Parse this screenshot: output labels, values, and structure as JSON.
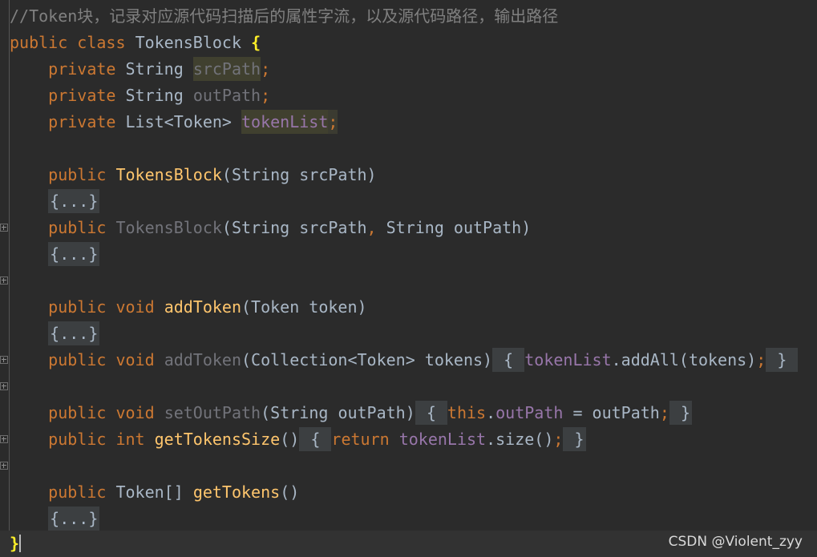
{
  "colors": {
    "background": "#2b2b2b",
    "keyword": "#cc7832",
    "method_declaration": "#ffc66d",
    "field": "#9876aa",
    "comment": "#808080",
    "unused": "#72737a",
    "default_text": "#a9b7c6",
    "matched_brace": "#ffef28",
    "fold_chip_background": "#3c3f41"
  },
  "code": {
    "comment": "//Token块，记录对应源代码扫描后的属性字流，以及源代码路径，输出路径",
    "class_decl": {
      "kw1": "public",
      "kw2": "class",
      "name": "TokensBlock",
      "open": "{"
    },
    "fields": [
      {
        "mod": "private",
        "type": "String",
        "name": "srcPath",
        "semi": ";"
      },
      {
        "mod": "private",
        "type": "String",
        "name": "outPath",
        "semi": ";"
      },
      {
        "mod": "private",
        "type": "List<Token>",
        "name": "tokenList",
        "semi": ";"
      }
    ],
    "ctor1": {
      "mod": "public",
      "name": "TokensBlock",
      "params": "(String srcPath)"
    },
    "ctor2": {
      "mod": "public",
      "name": "TokensBlock",
      "params_a": "(String srcPath",
      "comma": ",",
      "params_b": " String outPath)"
    },
    "fold_placeholder": "{...}",
    "add_token": {
      "mod": "public",
      "ret": "void",
      "name": "addToken",
      "params": "(Token token)"
    },
    "add_token2": {
      "mod": "public",
      "ret": "void",
      "name": "addToken",
      "params": "(Collection<Token> tokens)",
      "lb": "{",
      "field": "tokenList",
      "call": ".addAll(tokens)",
      "semi": ";",
      "rb": "}"
    },
    "set_out_path": {
      "mod": "public",
      "ret": "void",
      "name": "setOutPath",
      "params": "(String outPath)",
      "lb": "{",
      "this_kw": "this",
      "dot": ".",
      "field": "outPath",
      "assign": " = outPath",
      "semi": ";",
      "rb": "}"
    },
    "get_tokens_size": {
      "mod": "public",
      "ret": "int",
      "name": "getTokensSize",
      "params": "()",
      "lb": "{",
      "ret_kw": "return",
      "field": "tokenList",
      "call": ".size()",
      "semi": ";",
      "rb": "}"
    },
    "get_tokens": {
      "mod": "public",
      "ret": "Token[]",
      "name": "getTokens",
      "params": "()"
    },
    "class_close": "}"
  },
  "watermark": "CSDN @Violent_zyy"
}
